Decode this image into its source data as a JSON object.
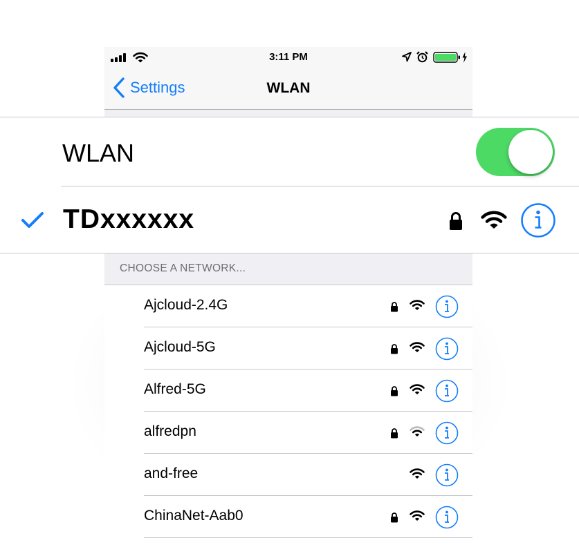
{
  "status_bar": {
    "time": "3:11 PM",
    "signal_icon": "cellular-signal-icon",
    "wifi_icon": "wifi-icon",
    "location_icon": "location-arrow-icon",
    "alarm_icon": "alarm-clock-icon",
    "battery_icon": "battery-charging-icon",
    "battery_color": "#4cd964"
  },
  "nav": {
    "back_label": "Settings",
    "title": "WLAN"
  },
  "wlan_toggle": {
    "label": "WLAN",
    "on": true,
    "on_color": "#4cd964"
  },
  "connected_network": {
    "name": "TDxxxxxx",
    "checked": true,
    "locked": true,
    "signal": "full"
  },
  "networks_section": {
    "header": "CHOOSE A NETWORK..."
  },
  "networks": [
    {
      "name": "Ajcloud-2.4G",
      "locked": true,
      "signal": "full"
    },
    {
      "name": "Ajcloud-5G",
      "locked": true,
      "signal": "full"
    },
    {
      "name": "Alfred-5G",
      "locked": true,
      "signal": "full"
    },
    {
      "name": "alfredpn",
      "locked": true,
      "signal": "weak"
    },
    {
      "name": "and-free",
      "locked": false,
      "signal": "full"
    },
    {
      "name": "ChinaNet-Aab0",
      "locked": true,
      "signal": "full"
    }
  ],
  "accent_color": "#147efb"
}
